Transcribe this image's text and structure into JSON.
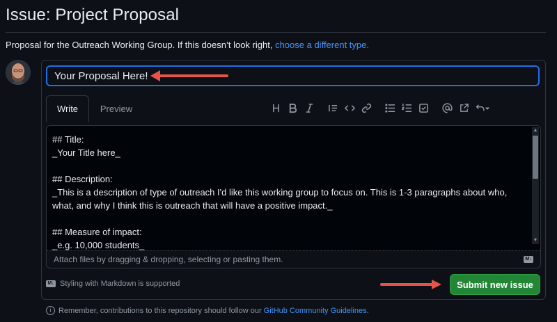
{
  "page": {
    "title": "Issue: Project Proposal",
    "intro_text": "Proposal for the Outreach Working Group. If this doesn’t look right,",
    "intro_link": "choose a different type."
  },
  "form": {
    "title_value": "Your Proposal Here!",
    "tabs": [
      {
        "label": "Write",
        "active": true
      },
      {
        "label": "Preview",
        "active": false
      }
    ],
    "toolbar_icons": [
      "heading-icon",
      "bold-icon",
      "italic-icon",
      "quote-icon",
      "code-icon",
      "link-icon",
      "unordered-list-icon",
      "ordered-list-icon",
      "task-list-icon",
      "mention-icon",
      "cross-reference-icon",
      "undo-dropdown-icon"
    ],
    "body_text": "## Title:\n_Your Title here_\n\n## Description:\n_This is a description of type of outreach I'd like this working group to focus on. This is 1-3 paragraphs about who, what, and why I think this is outreach that will have a positive impact._\n\n## Measure of impact:\n_e.g. 10,000 students_",
    "attach_text": "Attach files by dragging & dropping, selecting or pasting them.",
    "markdown_note": "Styling with Markdown is supported",
    "markdown_badge": "M↓",
    "submit_label": "Submit new issue"
  },
  "footer": {
    "text": "Remember, contributions to this repository should follow our",
    "link": "GitHub Community Guidelines",
    "end": "."
  },
  "colors": {
    "background": "#0d1117",
    "accent_blue": "#1f6feb",
    "link_blue": "#4493f8",
    "submit_green": "#238636",
    "annotation_red": "#e5534b"
  }
}
